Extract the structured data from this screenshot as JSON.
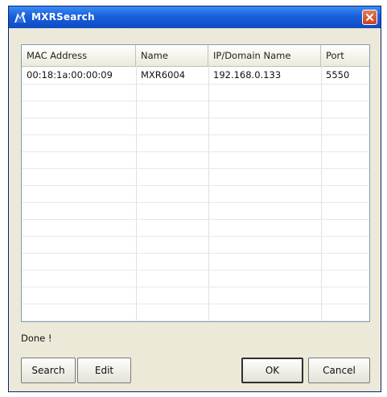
{
  "window": {
    "title": "MXRSearch",
    "icon": "mxr-app-icon",
    "close_icon": "close-icon",
    "accent_color": "#1a5edb"
  },
  "table": {
    "columns": [
      "MAC Address",
      "Name",
      "IP/Domain Name",
      "Port"
    ],
    "rows": [
      [
        "00:18:1a:00:00:09",
        "MXR6004",
        "192.168.0.133",
        "5550"
      ]
    ]
  },
  "status": "Done !",
  "buttons": {
    "search": "Search",
    "edit": "Edit",
    "ok": "OK",
    "cancel": "Cancel"
  }
}
